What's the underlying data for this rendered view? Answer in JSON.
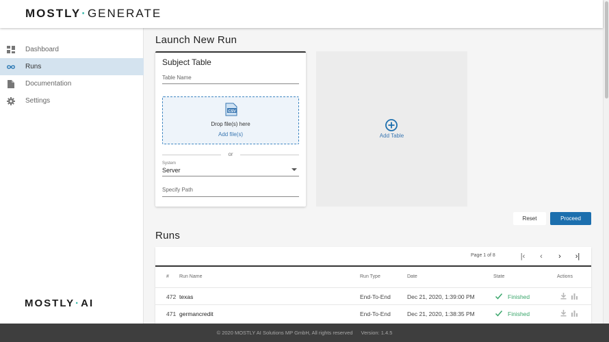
{
  "brand": {
    "part1": "MOSTLY",
    "separator": "·",
    "part2": "GENERATE"
  },
  "sidebar": {
    "items": [
      {
        "label": "Dashboard",
        "icon": "dashboard-icon",
        "active": false
      },
      {
        "label": "Runs",
        "icon": "infinity-icon",
        "active": true
      },
      {
        "label": "Documentation",
        "icon": "document-icon",
        "active": false
      },
      {
        "label": "Settings",
        "icon": "gear-icon",
        "active": false
      }
    ],
    "logo": {
      "part1": "MOSTLY",
      "separator": "·",
      "part2": "AI"
    }
  },
  "launch": {
    "title": "Launch New Run",
    "subject_table": {
      "title": "Subject Table",
      "table_name_label": "Table Name",
      "drop_text": "Drop file(s) here",
      "add_files": "Add file(s)",
      "or": "or",
      "system_label": "System",
      "system_value": "Server",
      "path_label": "Specify Path"
    },
    "add_table_label": "Add Table",
    "reset_label": "Reset",
    "proceed_label": "Proceed"
  },
  "runs": {
    "title": "Runs",
    "page_text": "Page 1 of 8",
    "columns": [
      "#",
      "Run Name",
      "Run Type",
      "Date",
      "State",
      "Actions"
    ],
    "rows": [
      {
        "id": "472",
        "name": "texas",
        "type": "End-To-End",
        "date": "Dec 21, 2020, 1:39:00 PM",
        "state": "Finished"
      },
      {
        "id": "471",
        "name": "germancredit",
        "type": "End-To-End",
        "date": "Dec 21, 2020, 1:38:35 PM",
        "state": "Finished"
      }
    ]
  },
  "footer": {
    "copyright": "© 2020 MOSTLY AI Solutions MP GmbH, All rights reserved",
    "version": "Version: 1.4.5"
  },
  "colors": {
    "accent": "#1c6fae",
    "brand_dot": "#2bb3a3",
    "success": "#3aa66b",
    "nav_active": "#d4e3ef"
  }
}
